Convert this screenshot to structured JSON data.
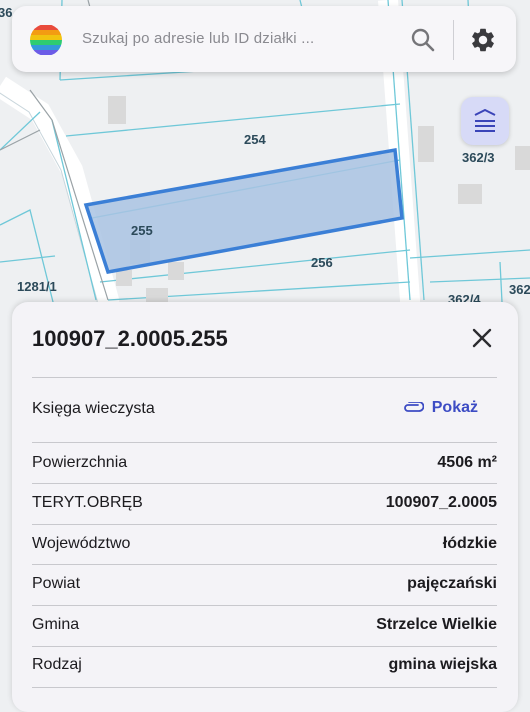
{
  "map": {
    "parcel_labels": [
      "254",
      "255",
      "256",
      "362/3",
      "1281/1",
      "362/4",
      "362",
      "36"
    ]
  },
  "search": {
    "placeholder": "Szukaj po adresie lub ID działki ..."
  },
  "logo": {
    "colors": [
      "#e94b3c",
      "#f39c12",
      "#f1c40f",
      "#2ecc71",
      "#3498db",
      "#6c5ce7"
    ]
  },
  "panel": {
    "title": "100907_2.0005.255",
    "land_registry": {
      "label": "Księga wieczysta",
      "link_label": "Pokaż"
    },
    "rows": [
      {
        "label": "Powierzchnia",
        "value": "4506 m²"
      },
      {
        "label": "TERYT.OBRĘB",
        "value": "100907_2.0005"
      },
      {
        "label": "Województwo",
        "value": "łódzkie"
      },
      {
        "label": "Powiat",
        "value": "pajęczański"
      },
      {
        "label": "Gmina",
        "value": "Strzelce Wielkie"
      },
      {
        "label": "Rodzaj",
        "value": "gmina wiejska"
      }
    ]
  },
  "colors": {
    "accent": "#3d4cc4",
    "selected_parcel_fill": "#a9c3e3",
    "selected_parcel_stroke": "#3b7fd6",
    "parcel_boundary": "#6fc8d8"
  }
}
